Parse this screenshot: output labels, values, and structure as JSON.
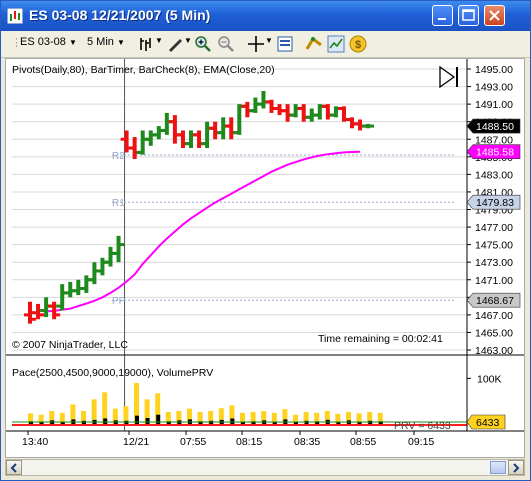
{
  "window": {
    "title": "ES 03-08  12/21/2007 (5 Min)"
  },
  "toolbar": {
    "instrument": "ES 03-08",
    "interval": "5 Min",
    "icons": [
      "bar-type-icon",
      "draw-tool-icon",
      "zoom-in-icon",
      "zoom-out-icon",
      "crosshair-icon",
      "properties-icon",
      "strategy-icon",
      "chart-style-icon",
      "dollar-icon"
    ]
  },
  "chart": {
    "indicators_label": "Pivots(Daily,80), BarTimer, BarCheck(8), EMA(Close,20)",
    "copyright": "© 2007 NinjaTrader, LLC",
    "time_remaining": "Time remaining = 00:02:41",
    "pivot_labels": {
      "r2": "R2",
      "r1": "R1",
      "pp": "PP"
    },
    "y_ticks": [
      "1495.00",
      "1493.00",
      "1491.00",
      "1489.00",
      "1487.00",
      "1485.00",
      "1483.00",
      "1481.00",
      "1479.00",
      "1477.00",
      "1475.00",
      "1473.00",
      "1471.00",
      "1469.00",
      "1467.00",
      "1465.00",
      "1463.00"
    ],
    "price_tags": [
      {
        "label": "1488.50",
        "value": 1488.5,
        "bg": "#000000",
        "fg": "#ffffff"
      },
      {
        "label": "1485.58",
        "value": 1485.58,
        "bg": "#ff00ff",
        "fg": "#ffffff"
      },
      {
        "label": "1479.83",
        "value": 1479.83,
        "bg": "#c6d3e8",
        "fg": "#000000"
      },
      {
        "label": "1468.67",
        "value": 1468.67,
        "bg": "#c8c8c8",
        "fg": "#000000"
      }
    ],
    "volume_label": "Pace(2500,4500,9000,19000), VolumePRV",
    "volume_ticks": [
      "100K"
    ],
    "prv_label": "PRV = 6433",
    "prv_tag": "6433",
    "x_ticks": [
      "13:40",
      "12/21",
      "07:55",
      "08:15",
      "08:35",
      "08:55",
      "09:15"
    ]
  },
  "colors": {
    "up_bar": "#1e8a1e",
    "down_bar": "#ee1111",
    "ema": "#ff00ff",
    "pace_yellow": "#ffd21f",
    "volume_black": "#000000",
    "titlebar": "#1f5fd6"
  },
  "chart_data": {
    "type": "bar",
    "title": "",
    "xlabel": "",
    "ylabel": "",
    "ylim": [
      1463,
      1495
    ],
    "bars": [
      [
        1467.0,
        1466.5,
        1468.5,
        1466.0
      ],
      [
        1467.25,
        1467.0,
        1468.25,
        1466.5
      ],
      [
        1467.5,
        1468.0,
        1469.0,
        1466.75
      ],
      [
        1468.0,
        1467.0,
        1468.5,
        1466.5
      ],
      [
        1468.0,
        1469.5,
        1470.5,
        1467.5
      ],
      [
        1469.5,
        1469.75,
        1470.75,
        1469.0
      ],
      [
        1469.75,
        1470.0,
        1471.0,
        1469.25
      ],
      [
        1470.0,
        1471.0,
        1471.5,
        1469.5
      ],
      [
        1471.0,
        1472.0,
        1473.0,
        1470.5
      ],
      [
        1472.0,
        1473.0,
        1473.5,
        1471.5
      ],
      [
        1473.0,
        1474.0,
        1474.75,
        1472.5
      ],
      [
        1474.0,
        1475.0,
        1476.0,
        1473.0
      ],
      [
        1487.0,
        1486.0,
        1488.0,
        1485.5
      ],
      [
        1486.0,
        1485.5,
        1487.25,
        1484.75
      ],
      [
        1485.5,
        1487.0,
        1488.0,
        1485.25
      ],
      [
        1487.0,
        1487.5,
        1488.0,
        1486.25
      ],
      [
        1487.5,
        1488.0,
        1488.5,
        1487.0
      ],
      [
        1488.0,
        1489.0,
        1490.0,
        1487.5
      ],
      [
        1489.0,
        1487.5,
        1489.75,
        1486.5
      ],
      [
        1487.5,
        1486.5,
        1488.0,
        1486.0
      ],
      [
        1486.5,
        1487.5,
        1488.0,
        1486.0
      ],
      [
        1487.5,
        1486.5,
        1488.0,
        1486.0
      ],
      [
        1486.5,
        1488.25,
        1489.0,
        1486.0
      ],
      [
        1488.25,
        1487.75,
        1489.0,
        1487.0
      ],
      [
        1487.75,
        1488.5,
        1489.5,
        1487.0
      ],
      [
        1488.5,
        1487.75,
        1489.5,
        1487.0
      ],
      [
        1487.75,
        1490.75,
        1491.0,
        1487.5
      ],
      [
        1490.75,
        1490.25,
        1491.25,
        1489.5
      ],
      [
        1490.25,
        1491.0,
        1491.75,
        1490.0
      ],
      [
        1491.0,
        1491.25,
        1492.5,
        1490.5
      ],
      [
        1491.25,
        1490.5,
        1491.5,
        1490.0
      ],
      [
        1490.5,
        1490.25,
        1491.0,
        1489.75
      ],
      [
        1490.25,
        1489.75,
        1491.0,
        1489.0
      ],
      [
        1489.75,
        1490.5,
        1491.0,
        1489.5
      ],
      [
        1490.5,
        1489.5,
        1491.0,
        1489.0
      ],
      [
        1489.5,
        1489.75,
        1490.5,
        1489.0
      ],
      [
        1489.75,
        1490.75,
        1491.0,
        1489.25
      ],
      [
        1490.75,
        1489.75,
        1491.0,
        1489.25
      ],
      [
        1489.75,
        1490.5,
        1490.75,
        1489.5
      ],
      [
        1490.5,
        1489.25,
        1490.75,
        1489.0
      ],
      [
        1489.25,
        1488.75,
        1489.5,
        1488.25
      ],
      [
        1488.75,
        1488.5,
        1489.25,
        1488.0
      ],
      [
        1488.5,
        1488.5,
        1488.75,
        1488.25
      ]
    ],
    "ema": [
      1467.4,
      1467.45,
      1467.6,
      1467.7,
      1468.0,
      1468.3,
      1468.6,
      1469.0,
      1469.5,
      1470.1,
      1470.8,
      1471.6,
      1472.8,
      1473.8,
      1474.8,
      1475.7,
      1476.5,
      1477.3,
      1478.0,
      1478.6,
      1479.2,
      1479.8,
      1480.3,
      1480.8,
      1481.3,
      1481.8,
      1482.3,
      1482.8,
      1483.3,
      1483.7,
      1484.1,
      1484.4,
      1484.7,
      1484.95,
      1485.15,
      1485.3,
      1485.4,
      1485.5,
      1485.55,
      1485.58
    ],
    "pivots": {
      "R2": 1485.2,
      "R1": 1479.83,
      "PP": 1468.67
    },
    "volume_max": 120000,
    "volume": [
      [
        8000,
        25000
      ],
      [
        6000,
        22000
      ],
      [
        10000,
        30000
      ],
      [
        7000,
        26000
      ],
      [
        12000,
        44000
      ],
      [
        9000,
        30000
      ],
      [
        11000,
        55000
      ],
      [
        14000,
        70000
      ],
      [
        10000,
        35000
      ],
      [
        9000,
        40000
      ],
      [
        20000,
        90000
      ],
      [
        15000,
        55000
      ],
      [
        22000,
        68000
      ],
      [
        8000,
        28000
      ],
      [
        10000,
        30000
      ],
      [
        12000,
        35000
      ],
      [
        8000,
        28000
      ],
      [
        9000,
        30000
      ],
      [
        11000,
        36000
      ],
      [
        14000,
        42000
      ],
      [
        6000,
        26000
      ],
      [
        8000,
        28000
      ],
      [
        10000,
        30000
      ],
      [
        7000,
        26000
      ],
      [
        12000,
        34000
      ],
      [
        6000,
        22000
      ],
      [
        9000,
        28000
      ],
      [
        8000,
        26000
      ],
      [
        11000,
        30000
      ],
      [
        6000,
        24000
      ],
      [
        10000,
        28000
      ],
      [
        7000,
        25000
      ],
      [
        9000,
        28000
      ],
      [
        8000,
        26000
      ]
    ]
  }
}
